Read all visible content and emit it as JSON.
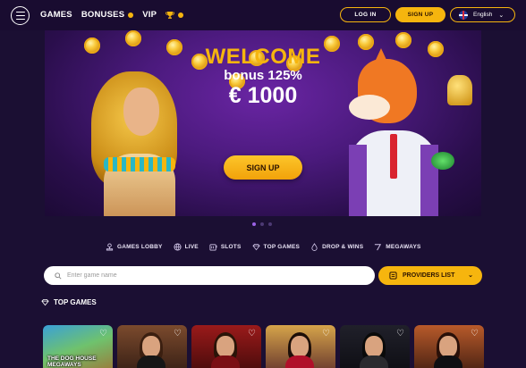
{
  "header": {
    "nav": [
      {
        "label": "GAMES",
        "icon": ""
      },
      {
        "label": "BONUSES",
        "icon": "badge-dot"
      },
      {
        "label": "VIP",
        "icon": ""
      }
    ],
    "trophy_icon": "trophy-icon",
    "login_label": "LOG IN",
    "signup_label": "SIGN UP",
    "language_label": "English",
    "accent_color": "#f6b50e"
  },
  "hero": {
    "welcome": "WELCOME",
    "bonus": "bonus 125%",
    "amount": "€ 1000",
    "signup_label": "SIGN UP",
    "slide_count": 3,
    "active_slide": 1
  },
  "categories": [
    {
      "label": "GAMES LOBBY",
      "icon": "joystick-icon"
    },
    {
      "label": "LIVE",
      "icon": "live-icon"
    },
    {
      "label": "SLOTS",
      "icon": "slots-icon"
    },
    {
      "label": "TOP GAMES",
      "icon": "diamond-icon"
    },
    {
      "label": "DROP & WINS",
      "icon": "drop-icon"
    },
    {
      "label": "MEGAWAYS",
      "icon": "megaways-icon"
    }
  ],
  "search": {
    "placeholder": "Enter game name",
    "providers_label": "PROVIDERS LIST"
  },
  "top_games": {
    "title": "TOP GAMES",
    "games": [
      {
        "title": "THE DOG HOUSE MEGAWAYS"
      },
      {
        "title": ""
      },
      {
        "title": ""
      },
      {
        "title": ""
      },
      {
        "title": ""
      },
      {
        "title": ""
      }
    ]
  }
}
